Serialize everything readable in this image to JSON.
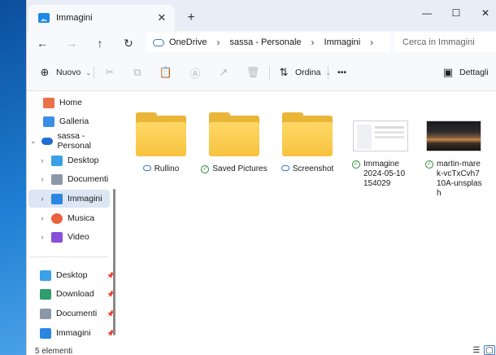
{
  "window": {
    "tab_title": "Immagini",
    "tab_close": "✕",
    "new_tab": "+",
    "controls": {
      "minimize": "—",
      "maximize": "☐",
      "close": "✕"
    }
  },
  "nav": {
    "back": "←",
    "forward": "→",
    "up": "↑",
    "refresh": "↻"
  },
  "address": {
    "crumbs": [
      "OneDrive",
      "sassa - Personale",
      "Immagini"
    ],
    "separator": "›",
    "search_placeholder": "Cerca in Immagini"
  },
  "toolbar": {
    "new_label": "Nuovo",
    "sort_label": "Ordina",
    "more": "•••",
    "details_label": "Dettagli",
    "chevron": "⌄"
  },
  "sidebar": {
    "top": [
      {
        "label": "Home",
        "color": "#e8734a"
      },
      {
        "label": "Galleria",
        "color": "#3a8ee6"
      },
      {
        "label": "sassa - Personal",
        "color": "#1e6fd0",
        "expanded": true
      }
    ],
    "tree": [
      {
        "label": "Desktop",
        "color": "#3aa0e8"
      },
      {
        "label": "Documenti",
        "color": "#8a97a8"
      },
      {
        "label": "Immagini",
        "color": "#2b86e0",
        "selected": true
      },
      {
        "label": "Musica",
        "color": "#e8623c"
      },
      {
        "label": "Video",
        "color": "#8a4fd8"
      }
    ],
    "quick": [
      {
        "label": "Desktop",
        "color": "#3aa0e8"
      },
      {
        "label": "Download",
        "color": "#2e9e6a"
      },
      {
        "label": "Documenti",
        "color": "#8a97a8"
      },
      {
        "label": "Immagini",
        "color": "#2b86e0"
      }
    ],
    "expand_closed": "›",
    "expand_open": "⌄",
    "pin": "📌"
  },
  "items": [
    {
      "name": "Rullino",
      "status": "cloud",
      "kind": "folder"
    },
    {
      "name": "Saved Pictures",
      "status": "ok",
      "kind": "folder"
    },
    {
      "name": "Screenshot",
      "status": "cloud",
      "kind": "folder"
    },
    {
      "name": "Immagine 2024-05-10 154029",
      "status": "ok",
      "kind": "screenshot"
    },
    {
      "name": "martin-marek-vcTxCvh710A-unsplash",
      "status": "ok",
      "kind": "photo"
    }
  ],
  "status": {
    "count_text": "5 elementi"
  }
}
